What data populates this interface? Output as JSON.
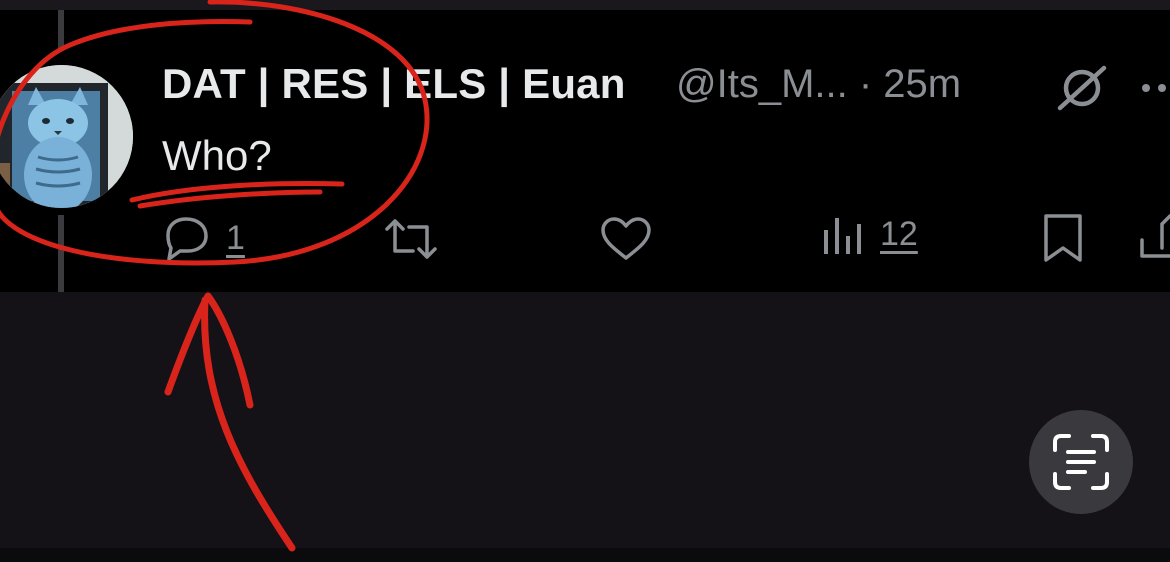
{
  "tweet": {
    "display_name": "DAT | RES | ELS | Euan",
    "handle_time": "@Its_M... · 25m",
    "text": "Who?",
    "reply_count": "1",
    "view_count": "12"
  },
  "colors": {
    "tweet_background": "#000000",
    "page_background": "#141216",
    "primary_text": "#e7e9ea",
    "secondary_text": "#8b8f94",
    "annotation_red": "#d9241c",
    "floating_button": "#3a393d"
  },
  "icons": {
    "grok": "grok-icon",
    "more": "more-icon",
    "reply": "reply-icon",
    "retweet": "retweet-icon",
    "like": "heart-icon",
    "views": "views-icon",
    "bookmark": "bookmark-icon",
    "share": "share-icon",
    "scan_text": "text-scan-icon"
  }
}
